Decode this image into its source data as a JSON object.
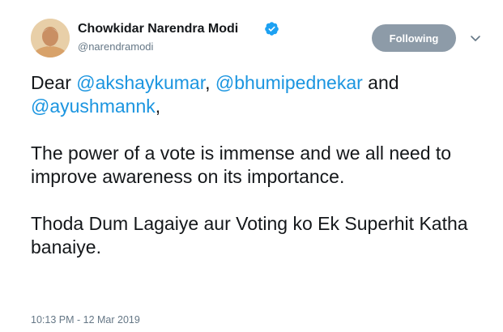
{
  "author": {
    "display_name": "Chowkidar Narendra Modi",
    "handle": "@narendramodi",
    "verified": true
  },
  "follow_button": {
    "label": "Following"
  },
  "tweet": {
    "line1_prefix": "Dear ",
    "mention_1": "@akshaykumar",
    "line1_sep": ", ",
    "mention_2": "@bhumipednekar",
    "line1_suffix": " and",
    "mention_3": "@ayushmannk",
    "line2_suffix": ",",
    "paragraph_2": "The power of a vote is immense and we all need to improve awareness on its importance.",
    "paragraph_3": "Thoda Dum Lagaiye aur Voting ko Ek Superhit Katha banaiye."
  },
  "timestamp": "10:13 PM - 12 Mar 2019",
  "colors": {
    "mention": "#1b95e0",
    "verified": "#1da1f2",
    "follow_button_bg": "#8d9ba8",
    "secondary_text": "#657786"
  },
  "icons": {
    "verified": "verified-badge-icon",
    "menu": "chevron-down-icon"
  }
}
